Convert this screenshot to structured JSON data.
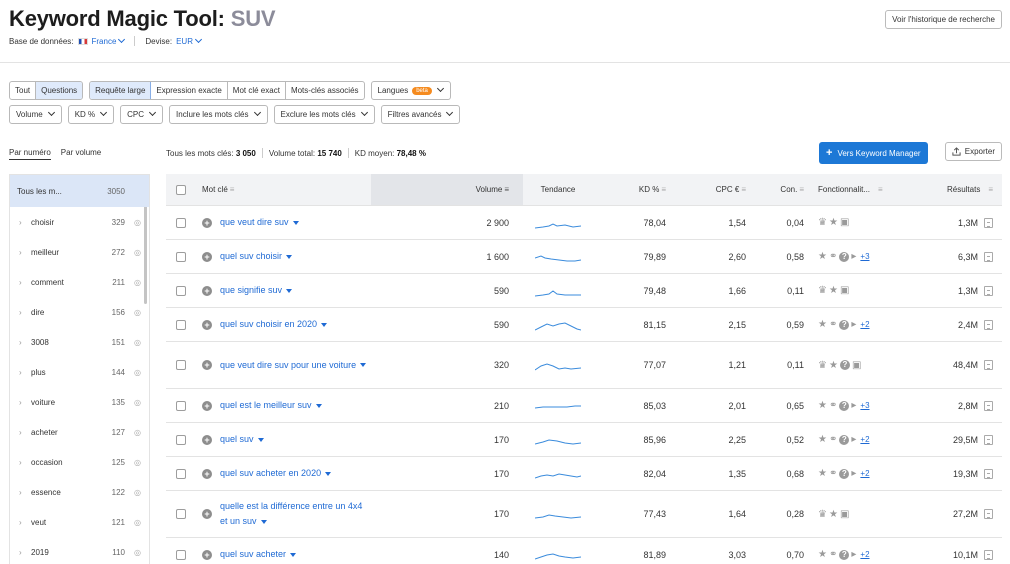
{
  "header": {
    "title_main": "Keyword Magic Tool:",
    "title_keyword": "SUV",
    "db_label": "Base de données:",
    "db_value": "France",
    "currency_label": "Devise:",
    "currency_value": "EUR",
    "history_button": "Voir l'historique de recherche"
  },
  "filters": {
    "match_all": "Tout",
    "match_questions": "Questions",
    "broad": "Requête large",
    "exact": "Expression exacte",
    "phrase": "Mot clé exact",
    "related": "Mots-clés associés",
    "languages": "Langues",
    "beta": "beta",
    "volume": "Volume",
    "kd": "KD %",
    "cpc": "CPC",
    "include": "Inclure les mots clés",
    "exclude": "Exclure les mots clés",
    "advanced": "Filtres avancés"
  },
  "side_tabs": {
    "by_number": "Par numéro",
    "by_volume": "Par volume"
  },
  "stats": {
    "all_label": "Tous les mots clés:",
    "all_value": "3 050",
    "volume_label": "Volume total:",
    "volume_value": "15 740",
    "kd_label": "KD moyen:",
    "kd_value": "78,48 %"
  },
  "buttons": {
    "keyword_manager": "Vers Keyword Manager",
    "export": "Exporter"
  },
  "sidebar": [
    {
      "label": "Tous les m...",
      "count": "3050"
    },
    {
      "label": "choisir",
      "count": "329"
    },
    {
      "label": "meilleur",
      "count": "272"
    },
    {
      "label": "comment",
      "count": "211"
    },
    {
      "label": "dire",
      "count": "156"
    },
    {
      "label": "3008",
      "count": "151"
    },
    {
      "label": "plus",
      "count": "144"
    },
    {
      "label": "voiture",
      "count": "135"
    },
    {
      "label": "acheter",
      "count": "127"
    },
    {
      "label": "occasion",
      "count": "125"
    },
    {
      "label": "essence",
      "count": "122"
    },
    {
      "label": "veut",
      "count": "121"
    },
    {
      "label": "2019",
      "count": "110"
    }
  ],
  "columns": {
    "keyword": "Mot clé",
    "volume": "Volume",
    "trend": "Tendance",
    "kd": "KD %",
    "cpc": "CPC €",
    "com": "Con.",
    "features": "Fonctionnalit...",
    "results": "Résultats"
  },
  "rows": [
    {
      "kw": "que veut dire suv",
      "vol": "2 900",
      "kd": "78,04",
      "cpc": "1,54",
      "com": "0,04",
      "feat": "crown,star,img",
      "more": "",
      "res": "1,3M",
      "h": 34
    },
    {
      "kw": "quel suv choisir",
      "vol": "1 600",
      "kd": "79,89",
      "cpc": "2,60",
      "com": "0,58",
      "feat": "star,link,q,video",
      "more": "+3",
      "res": "6,3M",
      "h": 34
    },
    {
      "kw": "que signifie suv",
      "vol": "590",
      "kd": "79,48",
      "cpc": "1,66",
      "com": "0,11",
      "feat": "crown,star,img",
      "more": "",
      "res": "1,3M",
      "h": 34
    },
    {
      "kw": "quel suv choisir en 2020",
      "vol": "590",
      "kd": "81,15",
      "cpc": "2,15",
      "com": "0,59",
      "feat": "star,link,q,video",
      "more": "+2",
      "res": "2,4M",
      "h": 34
    },
    {
      "kw": "que veut dire suv pour une voiture",
      "vol": "320",
      "kd": "77,07",
      "cpc": "1,21",
      "com": "0,11",
      "feat": "crown,star,q,img",
      "more": "",
      "res": "48,4M",
      "h": 47
    },
    {
      "kw": "quel est le meilleur suv",
      "vol": "210",
      "kd": "85,03",
      "cpc": "2,01",
      "com": "0,65",
      "feat": "star,link,q,video",
      "more": "+3",
      "res": "2,8M",
      "h": 34
    },
    {
      "kw": "quel suv",
      "vol": "170",
      "kd": "85,96",
      "cpc": "2,25",
      "com": "0,52",
      "feat": "star,link,q,video",
      "more": "+2",
      "res": "29,5M",
      "h": 34
    },
    {
      "kw": "quel suv acheter en 2020",
      "vol": "170",
      "kd": "82,04",
      "cpc": "1,35",
      "com": "0,68",
      "feat": "star,link,q,video",
      "more": "+2",
      "res": "19,3M",
      "h": 34
    },
    {
      "kw": "quelle est la différence entre un 4x4 et un suv",
      "vol": "170",
      "kd": "77,43",
      "cpc": "1,64",
      "com": "0,28",
      "feat": "crown,star,img",
      "more": "",
      "res": "27,2M",
      "h": 47
    },
    {
      "kw": "quel suv acheter",
      "vol": "140",
      "kd": "81,89",
      "cpc": "3,03",
      "com": "0,70",
      "feat": "star,link,q,video",
      "more": "+2",
      "res": "10,1M",
      "h": 34
    }
  ]
}
